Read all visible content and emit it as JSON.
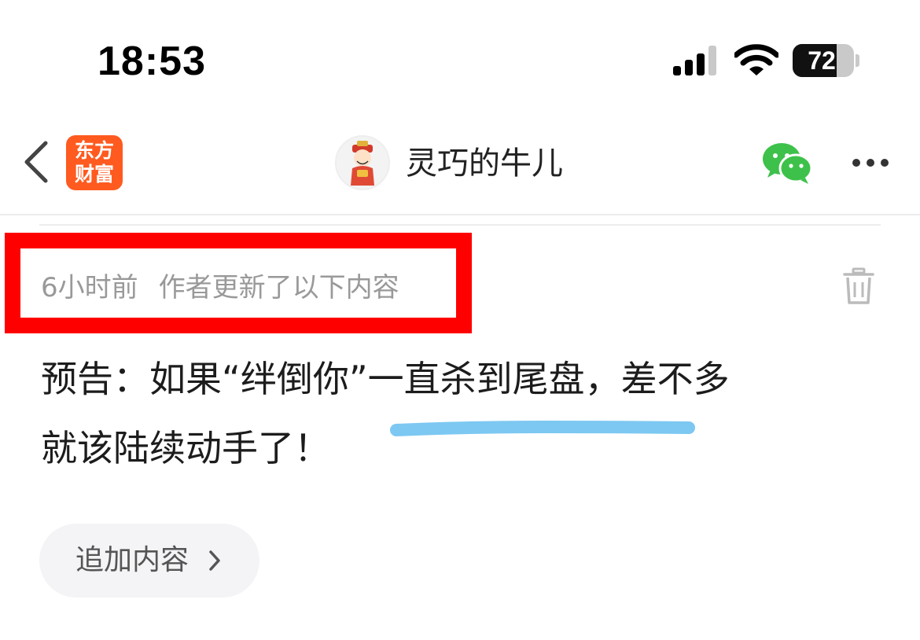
{
  "status_bar": {
    "time": "18:53",
    "battery_percent": "72",
    "battery_level": 0.72,
    "icons": [
      "signal-icon",
      "wifi-icon",
      "battery-icon"
    ]
  },
  "nav": {
    "back_icon": "chevron-left-icon",
    "logo_line1": "东方",
    "logo_line2": "财富",
    "channel_name": "灵巧的牛儿",
    "share_icon": "wechat-icon",
    "more_icon": "more-dots-icon"
  },
  "post": {
    "time_ago": "6小时前",
    "update_note": "作者更新了以下内容",
    "delete_icon": "trash-icon",
    "text_line1": "预告：如果“绊倒你”一直杀到尾盘，差不多",
    "text_line2": "就该陆续动手了！"
  },
  "append_button": {
    "label": "追加内容",
    "icon": "chevron-right-icon"
  },
  "colors": {
    "brand": "#ff5a1f",
    "highlight_box": "#ff0000",
    "underline_stroke": "#7cc8f2",
    "wechat_green": "#3ec14a"
  }
}
